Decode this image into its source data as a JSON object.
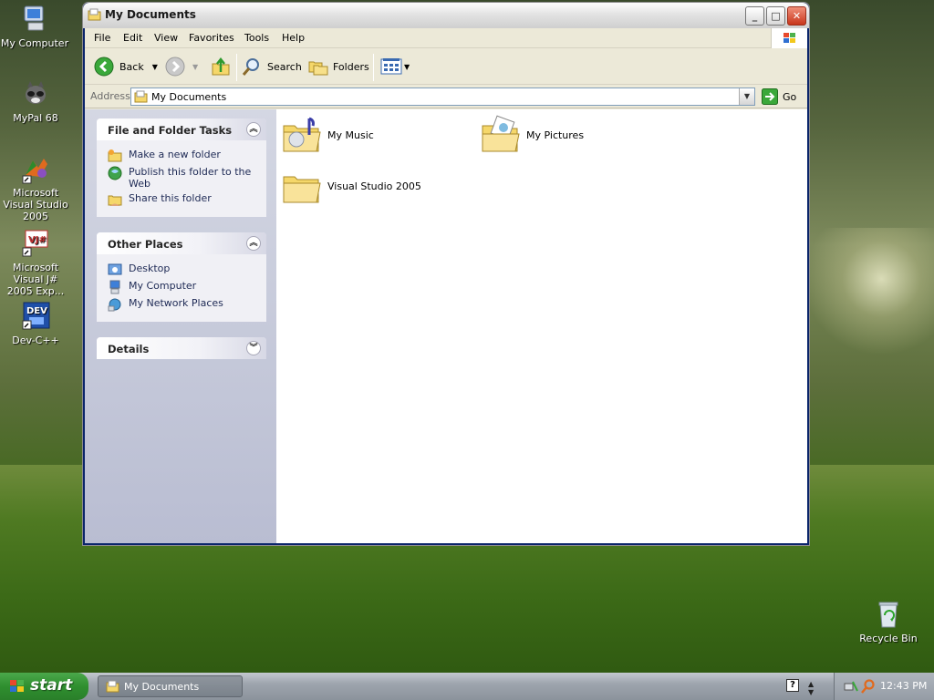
{
  "desktop": {
    "icons": [
      {
        "label": "My Computer"
      },
      {
        "label": "MyPal 68"
      },
      {
        "label": "Microsoft Visual Studio 2005"
      },
      {
        "label": "Microsoft Visual J# 2005 Exp..."
      },
      {
        "label": "Dev-C++"
      },
      {
        "label": "Recycle Bin"
      }
    ]
  },
  "window": {
    "title": "My Documents",
    "controls": {
      "minimize": "_",
      "maximize": "□",
      "close": "✕"
    }
  },
  "menu": {
    "items": [
      "File",
      "Edit",
      "View",
      "Favorites",
      "Tools",
      "Help"
    ]
  },
  "toolbar": {
    "back_label": "Back",
    "search_label": "Search",
    "folders_label": "Folders"
  },
  "address": {
    "label": "Address",
    "value": "My Documents",
    "go_label": "Go"
  },
  "taskpane": {
    "panels": [
      {
        "title": "File and Folder Tasks",
        "items": [
          "Make a new folder",
          "Publish this folder to the Web",
          "Share this folder"
        ]
      },
      {
        "title": "Other Places",
        "items": [
          "Desktop",
          "My Computer",
          "My Network Places"
        ]
      },
      {
        "title": "Details",
        "items": []
      }
    ]
  },
  "content": {
    "items": [
      {
        "label": "My Music",
        "icon": "music-folder-icon"
      },
      {
        "label": "My Pictures",
        "icon": "pictures-folder-icon"
      },
      {
        "label": "Visual Studio 2005",
        "icon": "folder-icon"
      }
    ]
  },
  "taskbar": {
    "start_label": "start",
    "task_label": "My Documents",
    "clock": "12:43 PM"
  },
  "colors": {
    "accent_blue": "#0a246a",
    "start_green": "#2f8f2f",
    "link_text": "#1e2a55"
  }
}
